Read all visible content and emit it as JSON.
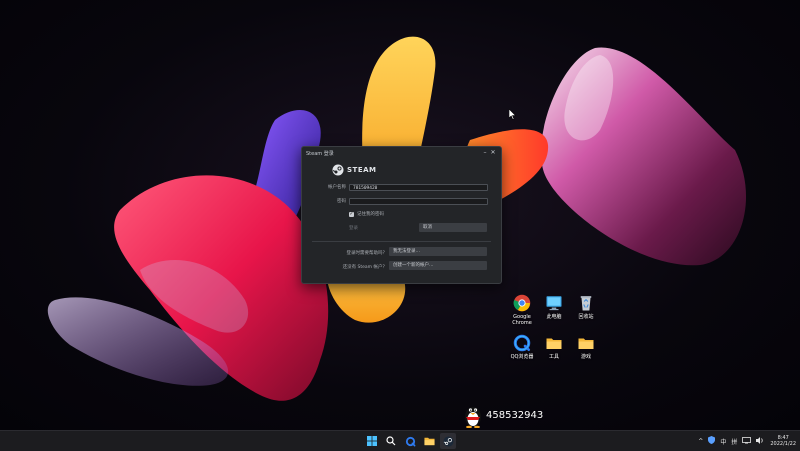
{
  "window": {
    "title": "Steam 登录",
    "brand": "STEAM",
    "username_label": "帐户名称",
    "username_value": "781509420",
    "password_label": "密码",
    "password_value": "",
    "remember_label": "记住我的密码",
    "login_label": "登录",
    "cancel_label": "取消",
    "help_question": "登录时需要帮助吗？",
    "help_button": "我无法登录…",
    "new_account_question": "还没有 Steam 帐户？",
    "new_account_button": "创建一个新的帐户…",
    "minimize_glyph": "–",
    "close_glyph": "✕"
  },
  "desktop_icons": [
    {
      "label": "Google\nChrome",
      "icon": "chrome-icon"
    },
    {
      "label": "此电脑",
      "icon": "monitor-icon"
    },
    {
      "label": "回收站",
      "icon": "recycle-bin-icon"
    },
    {
      "label": "QQ浏览器",
      "icon": "qq-browser-icon"
    },
    {
      "label": "工具",
      "icon": "folder-icon"
    },
    {
      "label": "游戏",
      "icon": "folder-icon"
    }
  ],
  "qq_overlay": {
    "number": "458532943",
    "icon": "qq-penguin-icon"
  },
  "taskbar": {
    "apps": [
      "windows-start-icon",
      "search-icon",
      "qq-browser-icon",
      "file-explorer-icon",
      "steam-icon"
    ],
    "tray": {
      "chevron": "^",
      "ime_lang": "中",
      "ime_mode": "拼",
      "time": "8:47",
      "date": "2022/1/22"
    }
  },
  "colors": {
    "window_bg": "#232528",
    "taskbar_bg": "#1c1c1f",
    "accent_blue": "#1a9fff"
  }
}
